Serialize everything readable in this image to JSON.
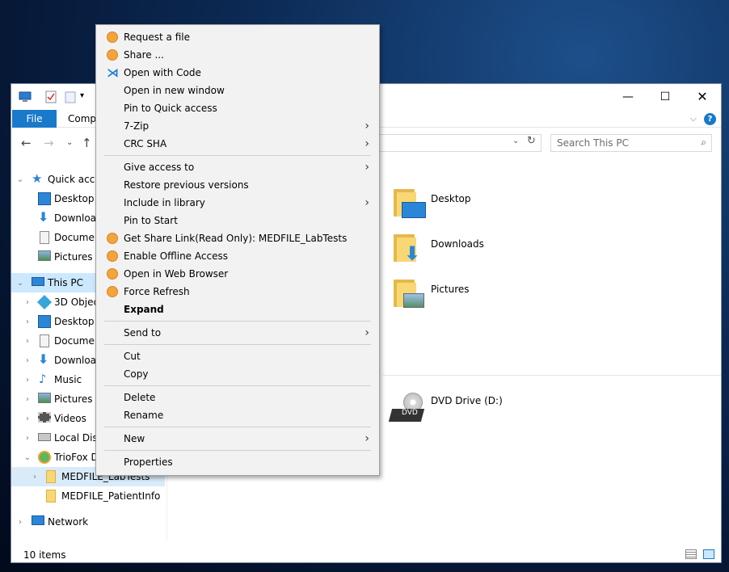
{
  "window": {
    "ribbon": {
      "file_tab": "File",
      "computer_tab": "Compu"
    },
    "search_placeholder": "Search This PC",
    "status": "10 items",
    "help": "?"
  },
  "navpane": {
    "quick_access": "Quick acce",
    "qa_items": [
      "Desktop",
      "Download",
      "Documen",
      "Pictures"
    ],
    "this_pc": "This PC",
    "pc_items": [
      "3D Object",
      "Desktop",
      "Documen",
      "Download",
      "Music",
      "Pictures",
      "Videos",
      "Local Disk"
    ],
    "triofox": "TrioFox D",
    "medfile_labtests": "MEDFILE_LabTests",
    "medfile_patientinfo": "MEDFILE_PatientInfo",
    "network": "Network"
  },
  "content": {
    "folders": [
      "Desktop",
      "Downloads",
      "Pictures"
    ],
    "dvd": "DVD Drive (D:)",
    "dvd_badge": "DVD"
  },
  "context_menu": {
    "items": [
      {
        "label": "Request a file",
        "icon": "triofox-icon"
      },
      {
        "label": "Share ...",
        "icon": "triofox-icon"
      },
      {
        "label": "Open with Code",
        "icon": "vscode-icon"
      },
      {
        "label": "Open in new window"
      },
      {
        "label": "Pin to Quick access"
      },
      {
        "label": "7-Zip",
        "submenu": true
      },
      {
        "label": "CRC SHA",
        "submenu": true
      },
      {
        "label": "Give access to",
        "submenu": true
      },
      {
        "label": "Restore previous versions"
      },
      {
        "label": "Include in library",
        "submenu": true
      },
      {
        "label": "Pin to Start"
      },
      {
        "label": "Get Share Link(Read Only): MEDFILE_LabTests",
        "icon": "triofox-icon"
      },
      {
        "label": "Enable Offline Access",
        "icon": "triofox-icon"
      },
      {
        "label": "Open in Web Browser",
        "icon": "triofox-icon"
      },
      {
        "label": "Force Refresh",
        "icon": "triofox-icon"
      },
      {
        "label": "Expand",
        "bold": true
      },
      {
        "label": "Send to",
        "submenu": true
      },
      {
        "label": "Cut"
      },
      {
        "label": "Copy"
      },
      {
        "label": "Delete"
      },
      {
        "label": "Rename"
      },
      {
        "label": "New",
        "submenu": true
      },
      {
        "label": "Properties"
      }
    ]
  },
  "colors": {
    "accent": "#1979ca",
    "selection": "#cce8ff",
    "menu_bg": "#f2f2f2"
  }
}
